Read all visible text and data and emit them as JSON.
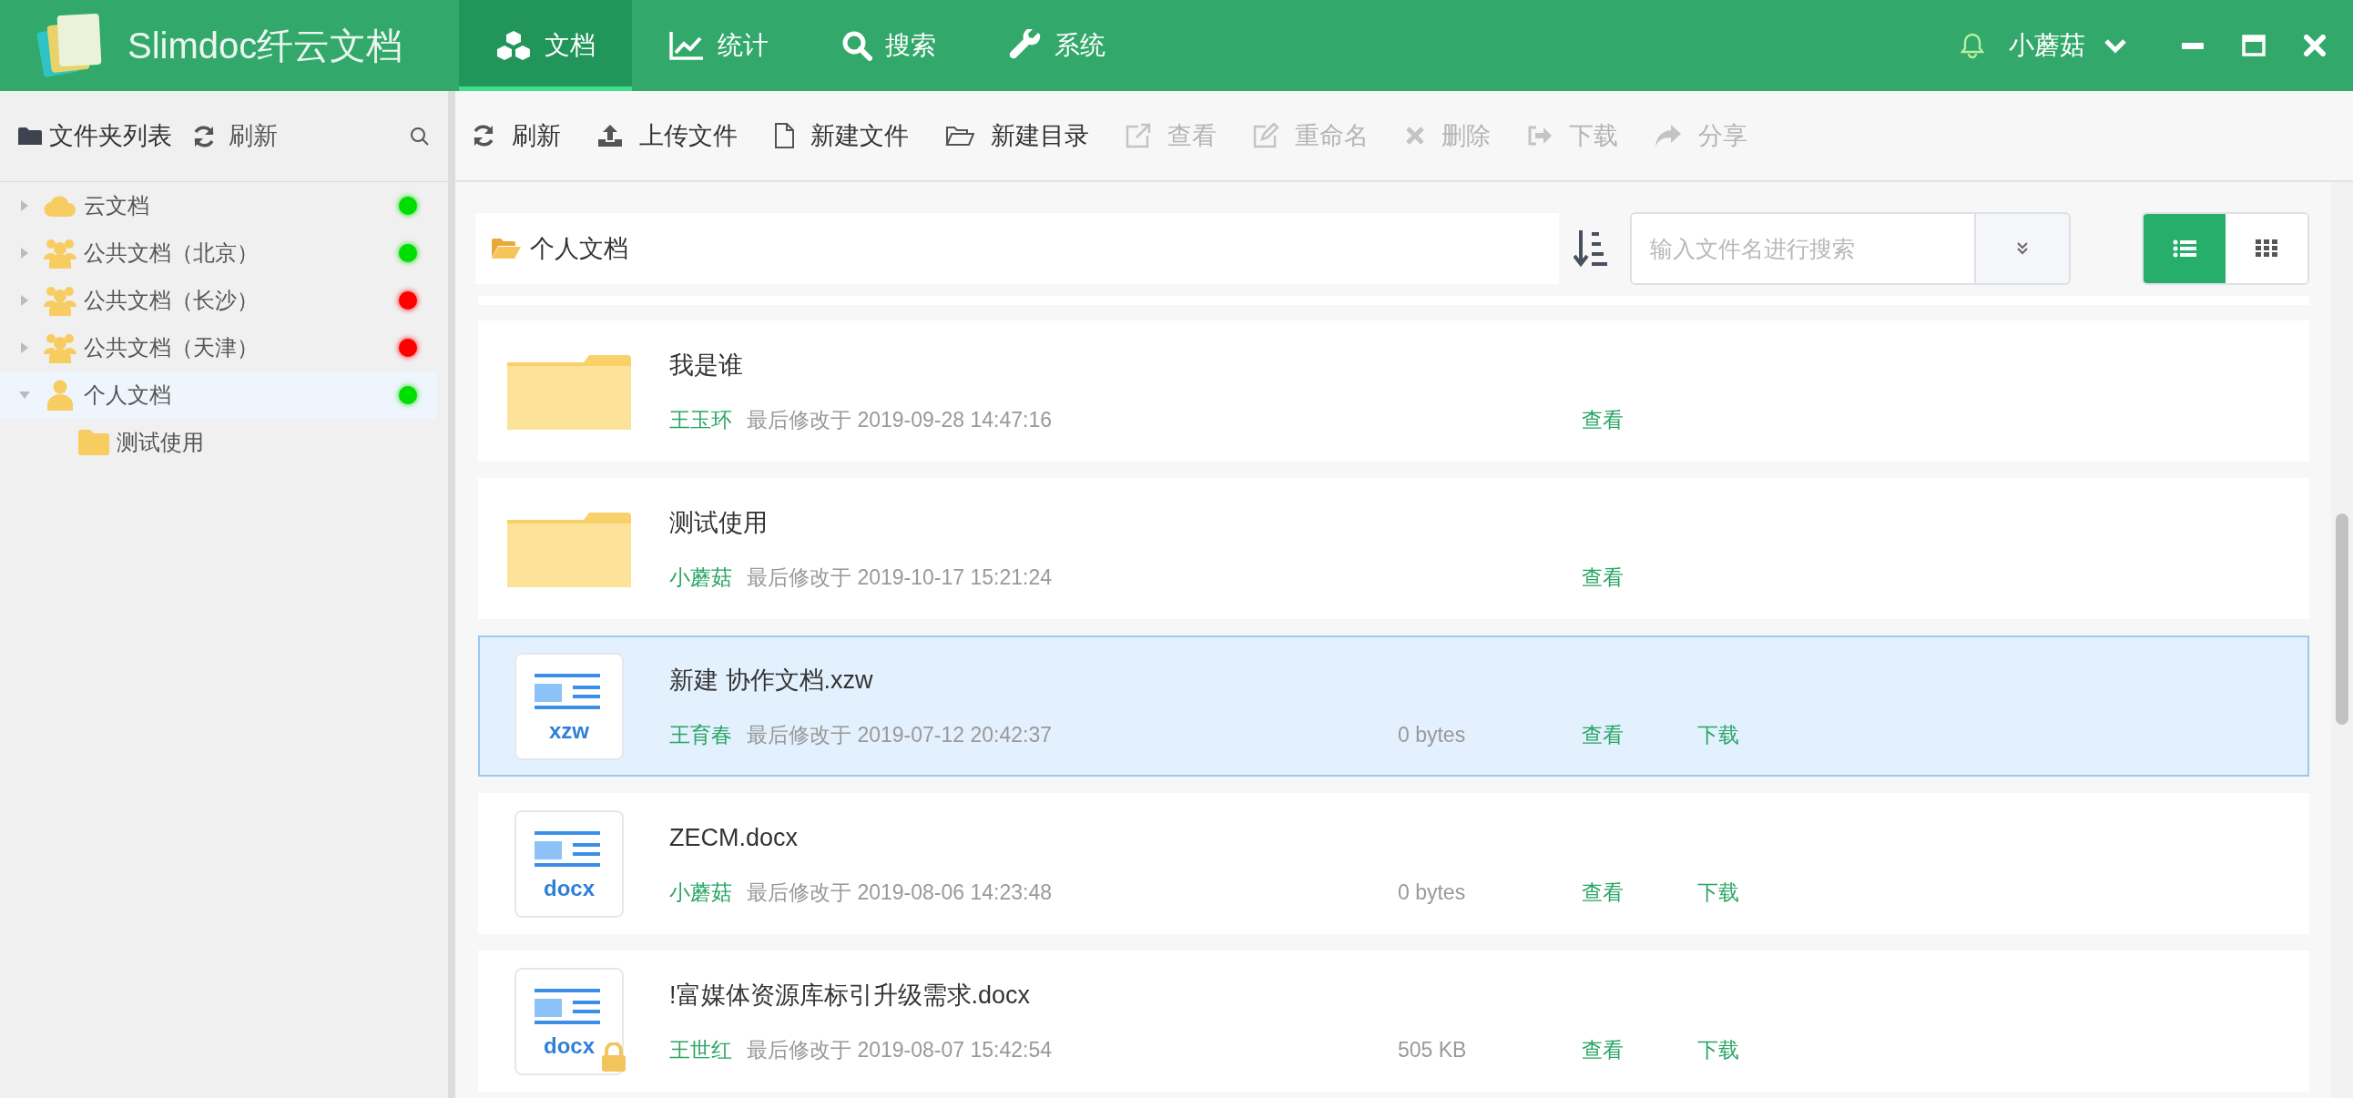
{
  "header": {
    "logo_text": "Slimdoc纤云文档",
    "nav_tabs": [
      {
        "label": "文档",
        "kind": "cubes",
        "selected": true
      },
      {
        "label": "统计",
        "kind": "chart",
        "selected": false
      },
      {
        "label": "搜索",
        "kind": "search",
        "selected": false
      },
      {
        "label": "系统",
        "kind": "wrench",
        "selected": false
      }
    ],
    "user": {
      "name": "小蘑菇"
    }
  },
  "sidebar": {
    "title": "文件夹列表",
    "refresh": "刷新",
    "tree": [
      {
        "label": "云文档",
        "kind": "cloud",
        "color": "#00dd00",
        "expanded": false,
        "selected": false
      },
      {
        "label": "公共文档（北京）",
        "kind": "group",
        "color": "#00dd00",
        "expanded": false,
        "selected": false
      },
      {
        "label": "公共文档（长沙）",
        "kind": "group",
        "color": "#ff0000",
        "expanded": false,
        "selected": false
      },
      {
        "label": "公共文档（天津）",
        "kind": "group",
        "color": "#ff0000",
        "expanded": false,
        "selected": false
      },
      {
        "label": "个人文档",
        "kind": "user",
        "color": "#00dd00",
        "expanded": true,
        "selected": true,
        "children": [
          {
            "label": "测试使用"
          }
        ]
      }
    ]
  },
  "toolbar": [
    {
      "label": "刷新",
      "kind": "refresh",
      "disabled": false
    },
    {
      "label": "上传文件",
      "kind": "upload",
      "disabled": false
    },
    {
      "label": "新建文件",
      "kind": "file",
      "disabled": false
    },
    {
      "label": "新建目录",
      "kind": "folder-open",
      "disabled": false
    },
    {
      "label": "查看",
      "kind": "external",
      "disabled": true
    },
    {
      "label": "重命名",
      "kind": "edit",
      "disabled": true
    },
    {
      "label": "删除",
      "kind": "times",
      "disabled": true
    },
    {
      "label": "下载",
      "kind": "signout",
      "disabled": true
    },
    {
      "label": "分享",
      "kind": "share",
      "disabled": true
    }
  ],
  "path": {
    "label": "个人文档"
  },
  "search": {
    "placeholder": "输入文件名进行搜索"
  },
  "view_toggle": [
    {
      "kind": "list",
      "selected": true
    },
    {
      "kind": "grid",
      "selected": false
    }
  ],
  "files": [
    {
      "kind": "folder",
      "name": "我是谁",
      "owner": "王玉环",
      "modified": "最后修改于 2019-09-28 14:47:16",
      "actions": [
        "查看"
      ],
      "selected": false
    },
    {
      "kind": "folder",
      "name": "测试使用",
      "owner": "小蘑菇",
      "modified": "最后修改于 2019-10-17 15:21:24",
      "actions": [
        "查看"
      ],
      "selected": false
    },
    {
      "kind": "file",
      "ext": "xzw",
      "locked": false,
      "name": "新建 协作文档.xzw",
      "owner": "王育春",
      "modified": "最后修改于 2019-07-12 20:42:37",
      "size": "0 bytes",
      "actions": [
        "查看",
        "下载"
      ],
      "selected": true
    },
    {
      "kind": "file",
      "ext": "docx",
      "locked": false,
      "name": "ZECM.docx",
      "owner": "小蘑菇",
      "modified": "最后修改于 2019-08-06 14:23:48",
      "size": "0 bytes",
      "actions": [
        "查看",
        "下载"
      ],
      "selected": false
    },
    {
      "kind": "file",
      "ext": "docx",
      "locked": true,
      "name": "!富媒体资源库标引升级需求.docx",
      "owner": "王世红",
      "modified": "最后修改于 2019-08-07 15:42:54",
      "size": "505 KB",
      "actions": [
        "查看",
        "下载"
      ],
      "selected": false
    }
  ]
}
